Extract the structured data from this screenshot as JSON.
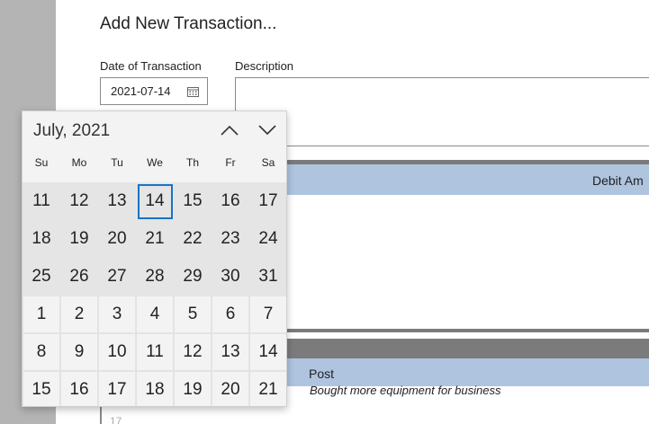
{
  "form": {
    "title": "Add New Transaction...",
    "date_label": "Date of Transaction",
    "date_value": "2021-07-14",
    "description_label": "Description",
    "description_value": ""
  },
  "grid": {
    "debit_header": "Debit Am",
    "post_header": "Post",
    "note": "Bought more equipment for business",
    "row_number": "17"
  },
  "calendar": {
    "month_label": "July, 2021",
    "weekdays": [
      "Su",
      "Mo",
      "Tu",
      "We",
      "Th",
      "Fr",
      "Sa"
    ],
    "selected_day": "14",
    "weeks": [
      [
        "11",
        "12",
        "13",
        "14",
        "15",
        "16",
        "17"
      ],
      [
        "18",
        "19",
        "20",
        "21",
        "22",
        "23",
        "24"
      ],
      [
        "25",
        "26",
        "27",
        "28",
        "29",
        "30",
        "31"
      ],
      [
        "1",
        "2",
        "3",
        "4",
        "5",
        "6",
        "7"
      ],
      [
        "8",
        "9",
        "10",
        "11",
        "12",
        "13",
        "14"
      ],
      [
        "15",
        "16",
        "17",
        "18",
        "19",
        "20",
        "21"
      ]
    ],
    "weeks_in_month": 3
  },
  "icons": {
    "date_picker": "calendar-icon",
    "previous_month": "chevron-up-icon",
    "next_month": "chevron-down-icon"
  },
  "colors": {
    "grid_header": "#afc4de",
    "grid_bar": "#7b7b7b",
    "selection_ring": "#1a73c4",
    "in_month_cell": "#e5e5e5"
  }
}
